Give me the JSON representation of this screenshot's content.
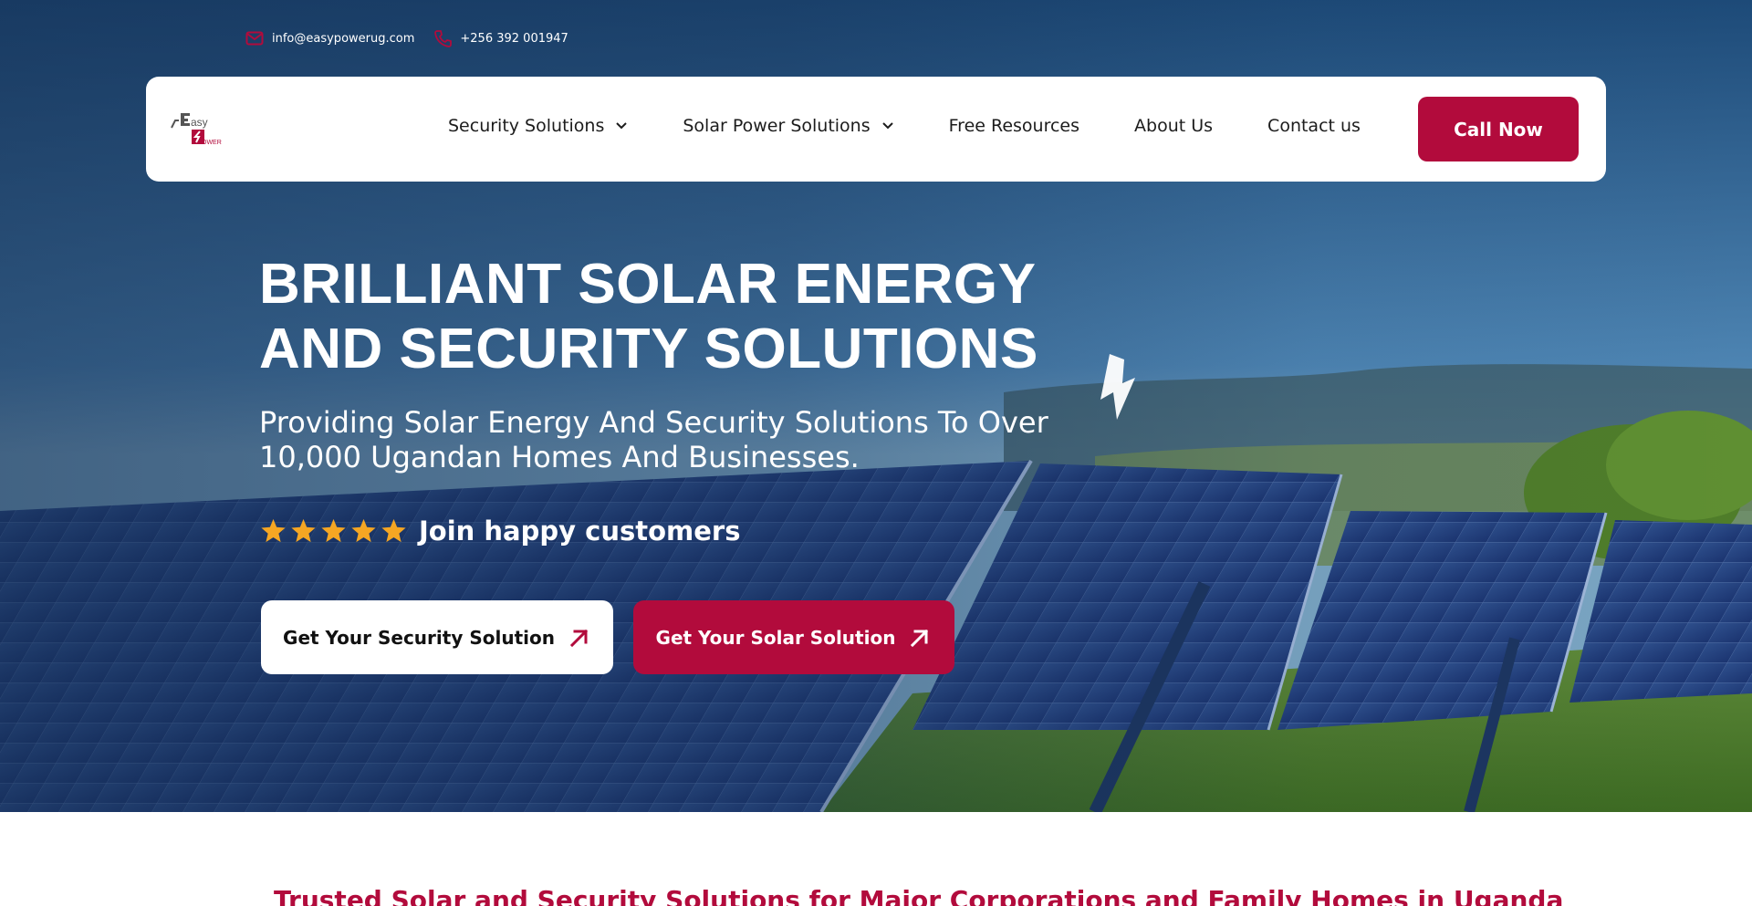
{
  "topbar": {
    "email": "info@easypowerug.com",
    "phone": "+256 392 001947",
    "email_icon": "envelope-icon",
    "phone_icon": "phone-icon"
  },
  "logo": {
    "alt": "Easy Power",
    "line1": "asy",
    "line2": "OWER"
  },
  "nav": {
    "items": [
      {
        "label": "Security Solutions",
        "has_dropdown": true
      },
      {
        "label": "Solar Power Solutions",
        "has_dropdown": true
      },
      {
        "label": "Free Resources",
        "has_dropdown": false
      },
      {
        "label": "About Us",
        "has_dropdown": false
      },
      {
        "label": "Contact us",
        "has_dropdown": false
      }
    ],
    "cta": "Call Now"
  },
  "hero": {
    "headline_line1": "BRILLIANT SOLAR ENERGY",
    "headline_line2": "AND SECURITY SOLUTIONS",
    "subline_line1": "Providing Solar Energy And Security Solutions To Over",
    "subline_line2": "10,000 Ugandan Homes And Businesses.",
    "rating_stars": 5,
    "rating_text": "Join happy customers",
    "btn_security": "Get Your Security Solution",
    "btn_solar": "Get Your Solar Solution"
  },
  "section": {
    "trusted_heading": "Trusted Solar and Security Solutions for Major Corporations and Family Homes in Uganda"
  },
  "colors": {
    "brand_red": "#b20b3c",
    "star_orange": "#f5a623",
    "white": "#ffffff"
  }
}
